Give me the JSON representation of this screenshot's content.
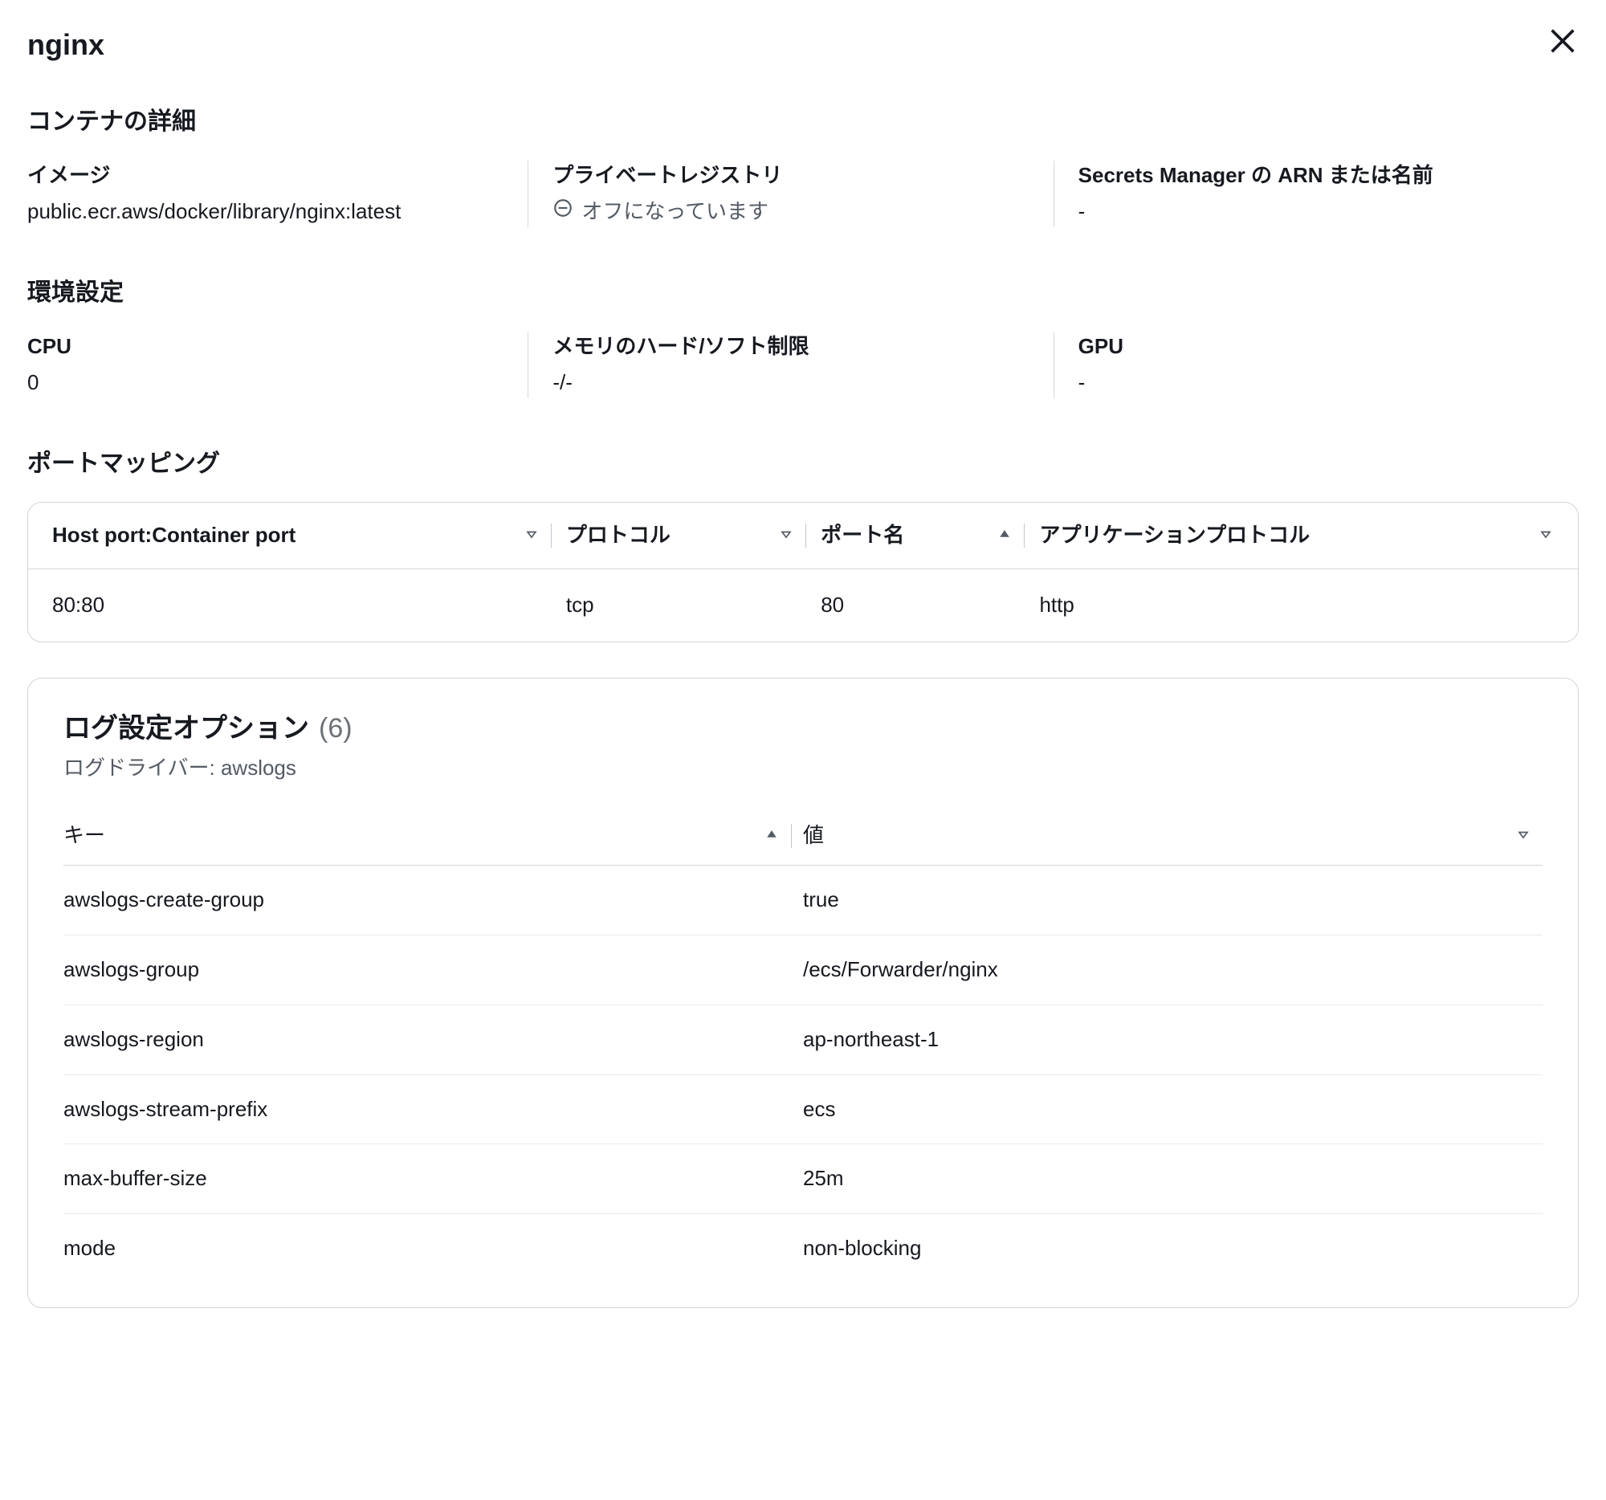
{
  "header": {
    "title": "nginx"
  },
  "container_details": {
    "heading": "コンテナの詳細",
    "image_label": "イメージ",
    "image_value": "public.ecr.aws/docker/library/nginx:latest",
    "private_registry_label": "プライベートレジストリ",
    "private_registry_status": "オフになっています",
    "secrets_label": "Secrets Manager の ARN または名前",
    "secrets_value": "-"
  },
  "env": {
    "heading": "環境設定",
    "cpu_label": "CPU",
    "cpu_value": "0",
    "memory_label": "メモリのハード/ソフト制限",
    "memory_value": "-/-",
    "gpu_label": "GPU",
    "gpu_value": "-"
  },
  "port_mapping": {
    "heading": "ポートマッピング",
    "cols": {
      "host_container": "Host port:Container port",
      "protocol": "プロトコル",
      "port_name": "ポート名",
      "app_protocol": "アプリケーションプロトコル"
    },
    "rows": [
      {
        "hc": "80:80",
        "protocol": "tcp",
        "name": "80",
        "app": "http"
      }
    ]
  },
  "log": {
    "title": "ログ設定オプション",
    "count": "(6)",
    "driver_label": "ログドライバー:",
    "driver_value": "awslogs",
    "key_col": "キー",
    "value_col": "値",
    "rows": [
      {
        "k": "awslogs-create-group",
        "v": "true"
      },
      {
        "k": "awslogs-group",
        "v": "/ecs/Forwarder/nginx"
      },
      {
        "k": "awslogs-region",
        "v": "ap-northeast-1"
      },
      {
        "k": "awslogs-stream-prefix",
        "v": "ecs"
      },
      {
        "k": "max-buffer-size",
        "v": "25m"
      },
      {
        "k": "mode",
        "v": "non-blocking"
      }
    ]
  }
}
